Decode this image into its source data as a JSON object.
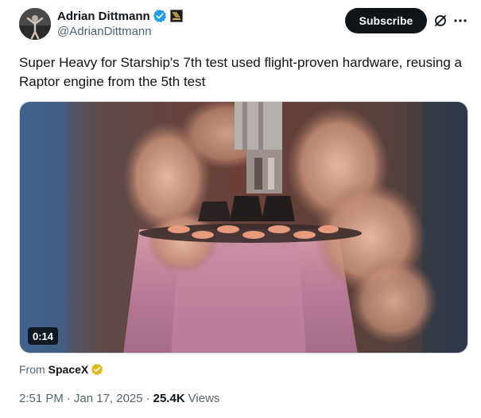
{
  "author": {
    "display_name": "Adrian Dittmann",
    "handle": "@AdrianDittmann",
    "verified_icon": "verified-badge-icon",
    "affiliate_icon": "affiliate-badge-icon",
    "verified_color": "#1d9bf0"
  },
  "actions": {
    "subscribe_label": "Subscribe",
    "grok_icon": "grok-icon",
    "more_icon": "more-icon"
  },
  "tweet": {
    "text": "Super Heavy for Starship's 7th test used flight-proven hardware, reusing a Raptor engine from the 5th test"
  },
  "media": {
    "duration": "0:14",
    "image_icon": "rocket-launch-video"
  },
  "source": {
    "prefix": "From",
    "name": "SpaceX",
    "badge_color": "#e2b719"
  },
  "meta": {
    "time": "2:51 PM",
    "separator": "·",
    "date": "Jan 17, 2025",
    "views_count": "25.4K",
    "views_label": "Views"
  },
  "colors": {
    "text_primary": "#0f1419",
    "text_secondary": "#536471",
    "button_bg": "#0f1419"
  }
}
